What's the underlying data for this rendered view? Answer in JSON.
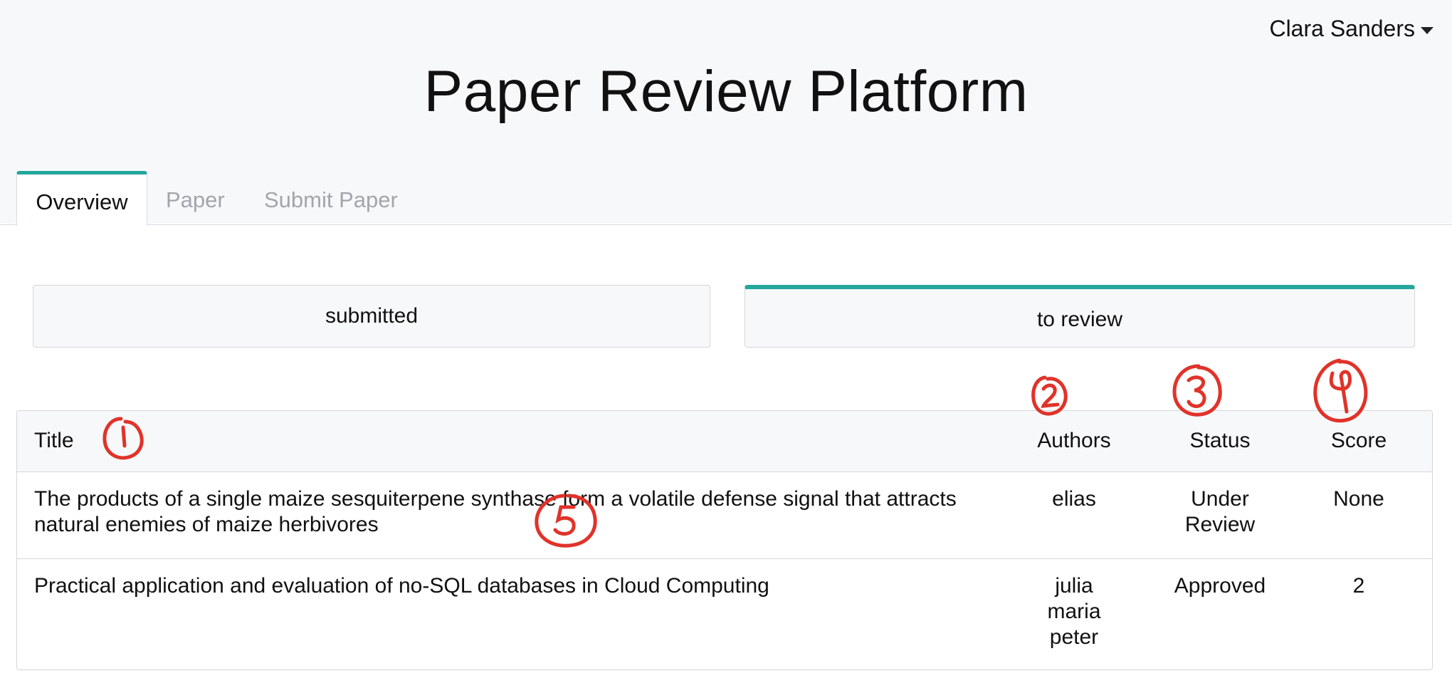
{
  "user": {
    "name": "Clara Sanders"
  },
  "header": {
    "title": "Paper Review Platform"
  },
  "tabs": [
    {
      "label": "Overview",
      "active": true
    },
    {
      "label": "Paper",
      "active": false
    },
    {
      "label": "Submit Paper",
      "active": false
    }
  ],
  "subtabs": [
    {
      "label": "submitted",
      "active": false
    },
    {
      "label": "to review",
      "active": true
    }
  ],
  "table": {
    "columns": [
      "Title",
      "Authors",
      "Status",
      "Score"
    ],
    "rows": [
      {
        "title": "The products of a single maize sesquiterpene synthase form a volatile defense signal that attracts natural enemies of maize herbivores",
        "authors": "elias",
        "status": "Under Review",
        "score": "None"
      },
      {
        "title": "Practical application and evaluation of no-SQL databases in Cloud Computing",
        "authors": "julia maria peter",
        "status": "Approved",
        "score": "2"
      }
    ]
  },
  "annotations": [
    "1",
    "2",
    "3",
    "4",
    "5"
  ],
  "colors": {
    "accent": "#22a79a",
    "annotation": "#e0332a",
    "header_bg": "#f7f8fa"
  }
}
